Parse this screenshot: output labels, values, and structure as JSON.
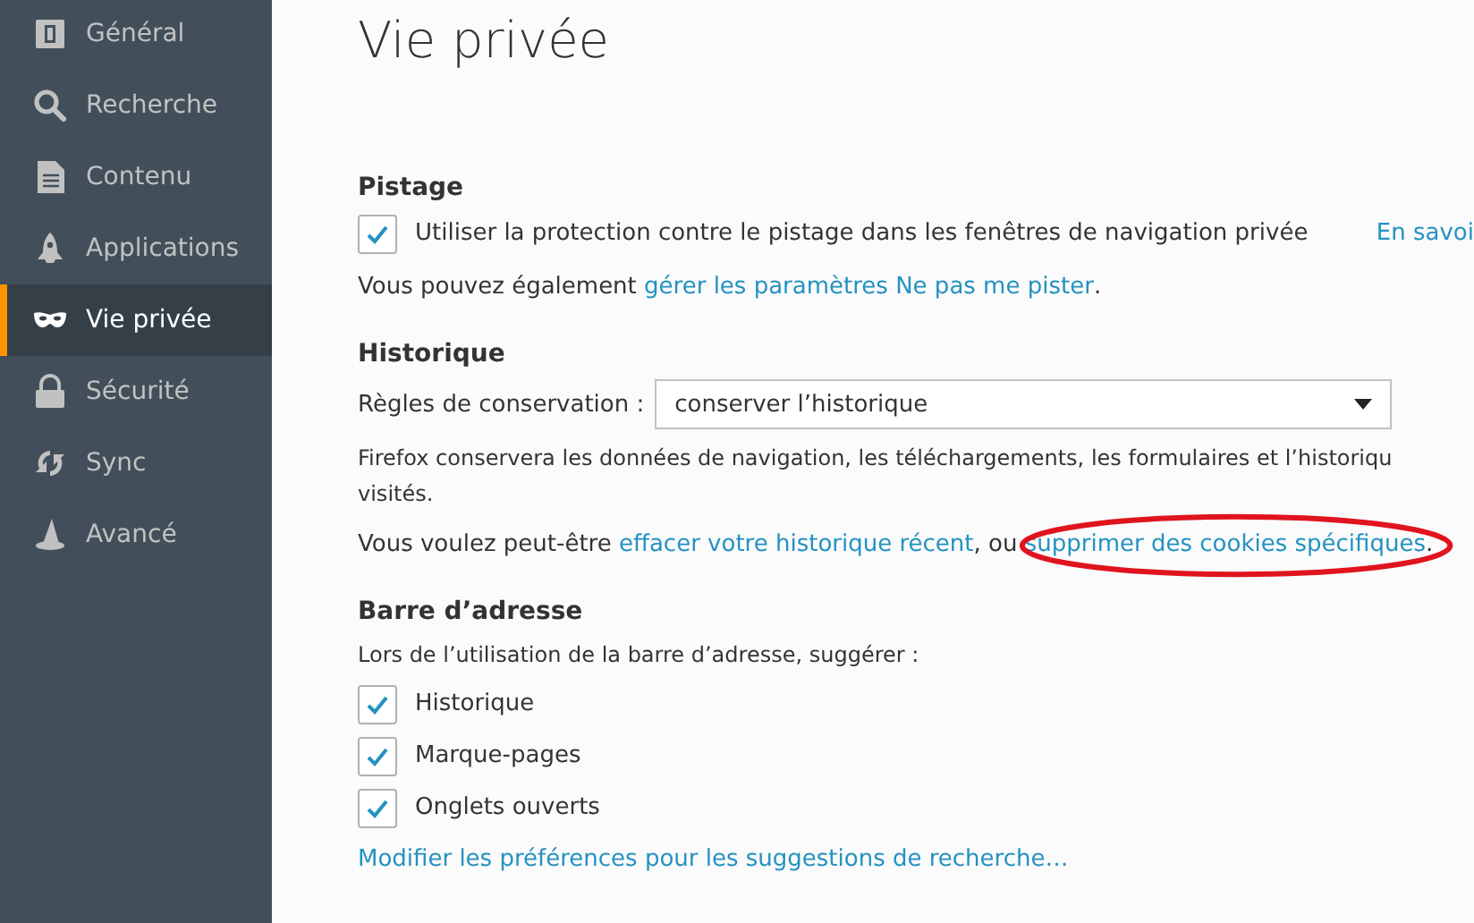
{
  "sidebar": {
    "items": [
      {
        "label": "Général",
        "selected": false
      },
      {
        "label": "Recherche",
        "selected": false
      },
      {
        "label": "Contenu",
        "selected": false
      },
      {
        "label": "Applications",
        "selected": false
      },
      {
        "label": "Vie privée",
        "selected": true
      },
      {
        "label": "Sécurité",
        "selected": false
      },
      {
        "label": "Sync",
        "selected": false
      },
      {
        "label": "Avancé",
        "selected": false
      }
    ]
  },
  "page": {
    "title": "Vie privée",
    "sections": [
      {
        "heading": "Pistage",
        "items": [
          {
            "kind": "checkbox",
            "label": "Utiliser la protection contre le pistage dans les fenêtres de navigation privée",
            "checked": true,
            "link": "En savoi"
          },
          {
            "kind": "sentence",
            "parts": [
              {
                "text": "Vous pouvez également "
              },
              {
                "text": "gérer les paramètres Ne pas me pister",
                "link": true,
                "circled": false
              },
              {
                "text": "."
              }
            ]
          }
        ]
      },
      {
        "heading": "Historique",
        "items": [
          {
            "kind": "select",
            "label": "Règles de conservation :",
            "value": "conserver l’historique"
          },
          {
            "kind": "paragraph",
            "text": "Firefox conservera les données de navigation, les téléchargements, les formulaires et l’historiqu\nvisités."
          },
          {
            "kind": "sentence",
            "parts": [
              {
                "text": "Vous voulez peut-être "
              },
              {
                "text": "effacer votre historique récent",
                "link": true,
                "circled": false
              },
              {
                "text": ", ou "
              },
              {
                "text": "supprimer des cookies spécifiques",
                "link": true,
                "circled": true
              },
              {
                "text": "."
              }
            ]
          }
        ]
      },
      {
        "heading": "Barre d’adresse",
        "items": [
          {
            "kind": "paragraph",
            "text": "Lors de l’utilisation de la barre d’adresse, suggérer :"
          },
          {
            "kind": "checkbox",
            "label": "Historique",
            "checked": true
          },
          {
            "kind": "checkbox",
            "label": "Marque-pages",
            "checked": true
          },
          {
            "kind": "checkbox",
            "label": "Onglets ouverts",
            "checked": true
          },
          {
            "kind": "link",
            "text": "Modifier les préférences pour les suggestions de recherche…"
          }
        ]
      }
    ]
  }
}
